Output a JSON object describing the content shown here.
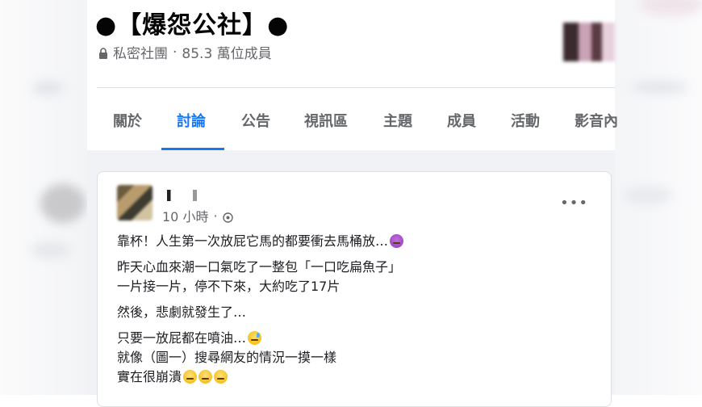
{
  "group": {
    "title": "●【爆怨公社】●",
    "privacy": "私密社團",
    "members": "85.3 萬位成員"
  },
  "tabs": [
    {
      "label": "關於"
    },
    {
      "label": "討論"
    },
    {
      "label": "公告"
    },
    {
      "label": "視訊區"
    },
    {
      "label": "主題"
    },
    {
      "label": "成員"
    },
    {
      "label": "活動"
    },
    {
      "label": "影音內"
    }
  ],
  "active_tab": "討論",
  "post": {
    "time": "10 小時",
    "more_label": "•••",
    "lines": [
      "靠杯！人生第一次放屁它馬的都要衝去馬桶放…",
      "昨天心血來潮一口氣吃了一整包「一口吃扁魚子」",
      "一片接一片，停不下來，大約吃了17片",
      "然後，悲劇就發生了…",
      "只要一放屁都在噴油…",
      "就像（圖一）搜尋網友的情況一摸一樣",
      "實在很崩潰"
    ]
  },
  "icons": {
    "privacy": "lock-icon",
    "audience": "globe-icon",
    "emoji_1": "angry-face-emoji",
    "emoji_2": "cold-sweat-emoji",
    "emoji_3": "tired-face-emoji"
  },
  "colors": {
    "accent": "#1877f2",
    "secondary_text": "#65676b",
    "feed_bg": "#f0f2f5"
  }
}
